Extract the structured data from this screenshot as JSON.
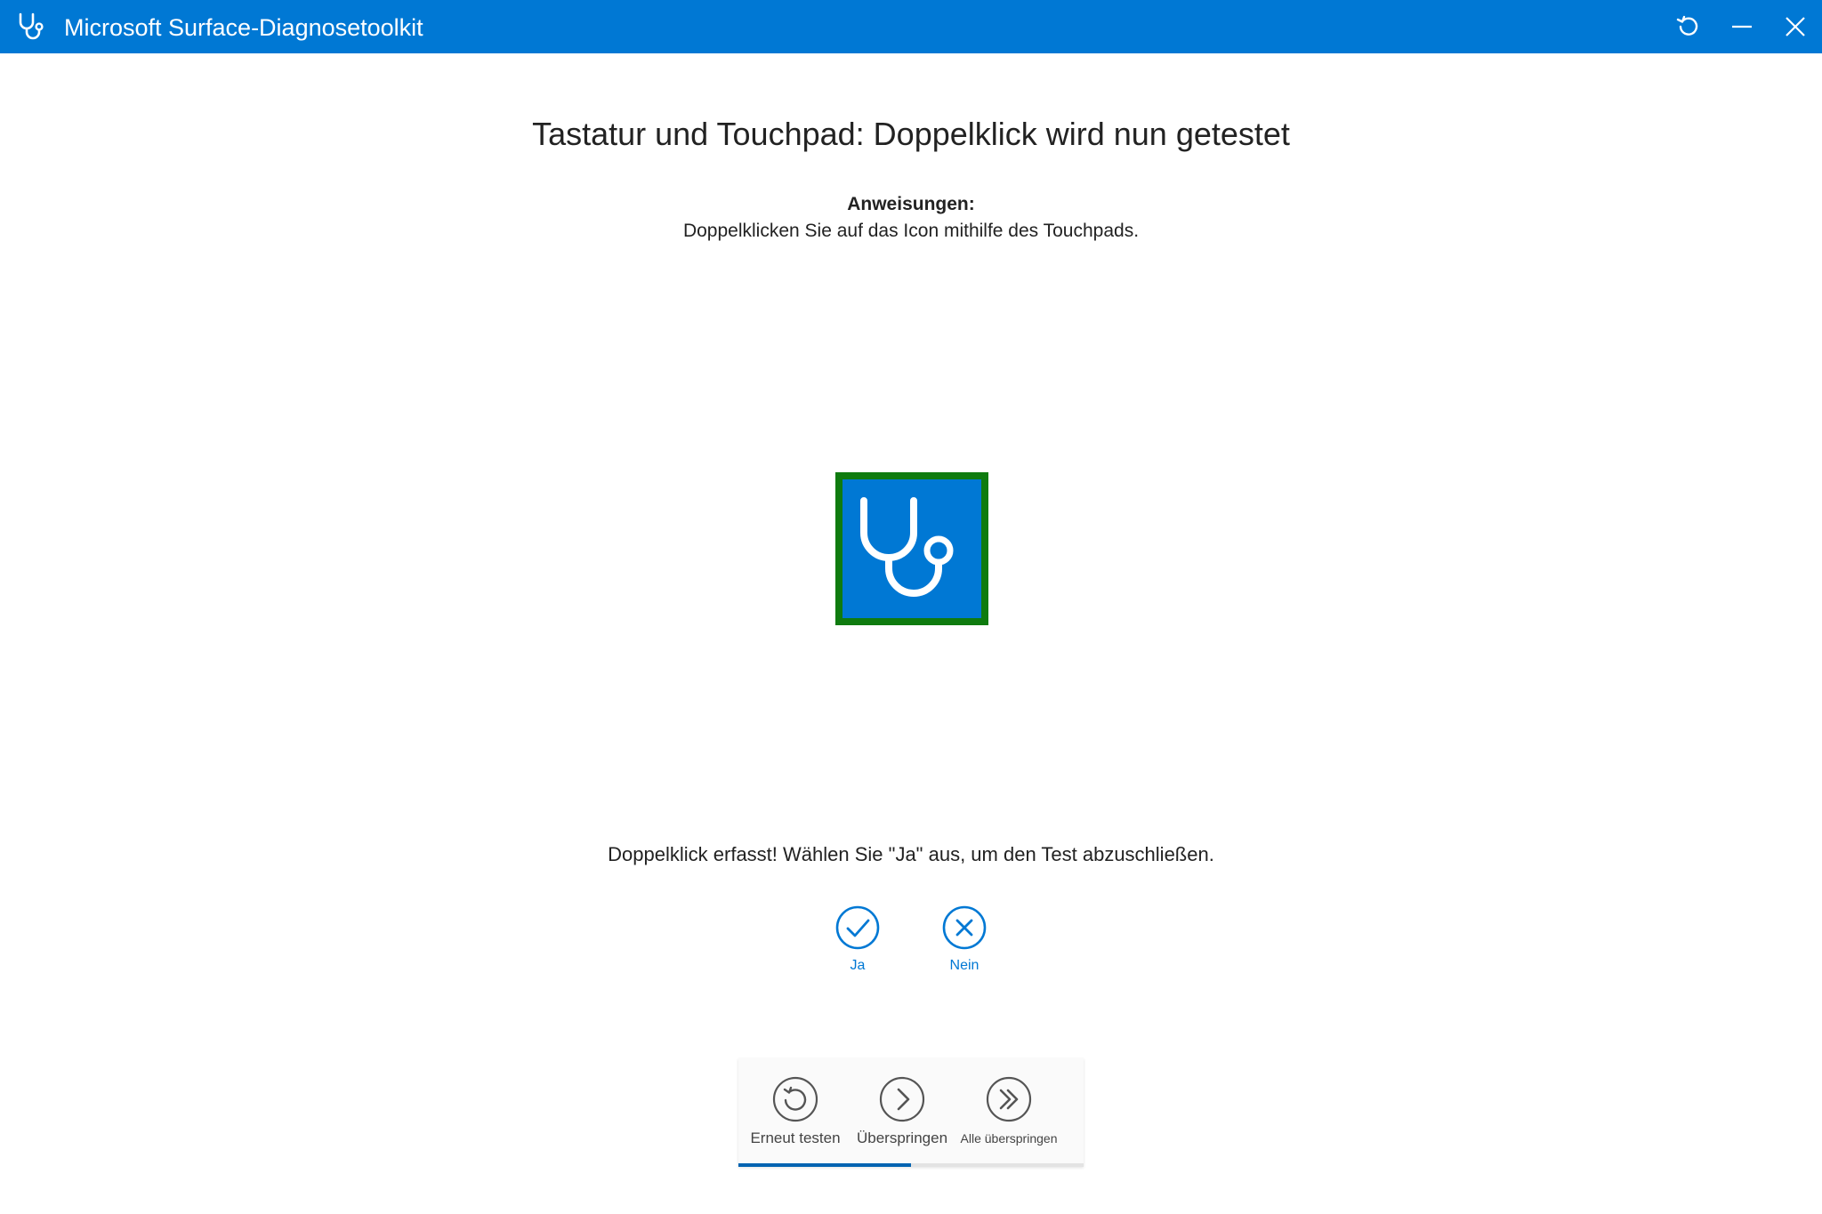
{
  "window": {
    "title": "Microsoft Surface-Diagnosetoolkit",
    "app_icon": "stethoscope-icon",
    "controls": [
      "refresh-icon",
      "minimize-icon",
      "close-icon"
    ]
  },
  "test": {
    "title": "Tastatur und Touchpad: Doppelklick wird nun getestet",
    "instructions_heading": "Anweisungen:",
    "instructions_text": "Doppelklicken Sie auf das Icon mithilfe des Touchpads.",
    "target_icon": "stethoscope-icon",
    "status": "Doppelklick erfasst! Wählen Sie \"Ja\" aus, um den Test abzuschließen."
  },
  "answers": {
    "yes_label": "Ja",
    "no_label": "Nein"
  },
  "toolbar": {
    "retry_label": "Erneut testen",
    "skip_label": "Überspringen",
    "skip_all_label": "Alle überspringen",
    "progress": 0.5
  },
  "colors": {
    "accent": "#0078d4",
    "target_border": "#0f7b0f",
    "progress": "#0063b1"
  }
}
